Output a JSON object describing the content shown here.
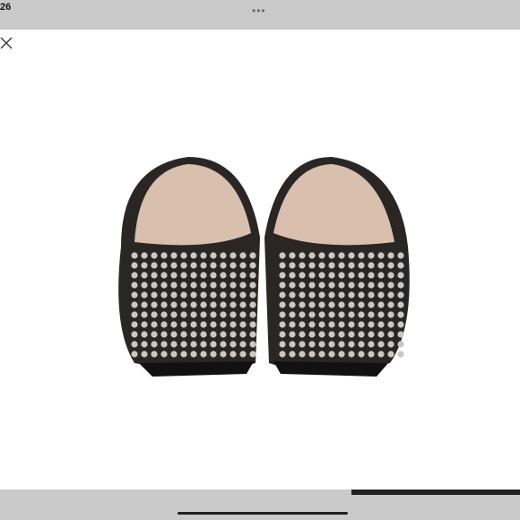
{
  "status_bar": {
    "time": "26",
    "more_icon": "ellipsis-icon"
  },
  "viewer": {
    "close_icon": "close-icon",
    "image_subject": "studded-flats-rear-view"
  },
  "gallery": {
    "progress": 0.32
  },
  "colors": {
    "bars": "#c9cac9",
    "accent_dark": "#222222",
    "leather": "#2a2624",
    "lining": "#d8bfae",
    "studs": "#c8c8c4"
  }
}
